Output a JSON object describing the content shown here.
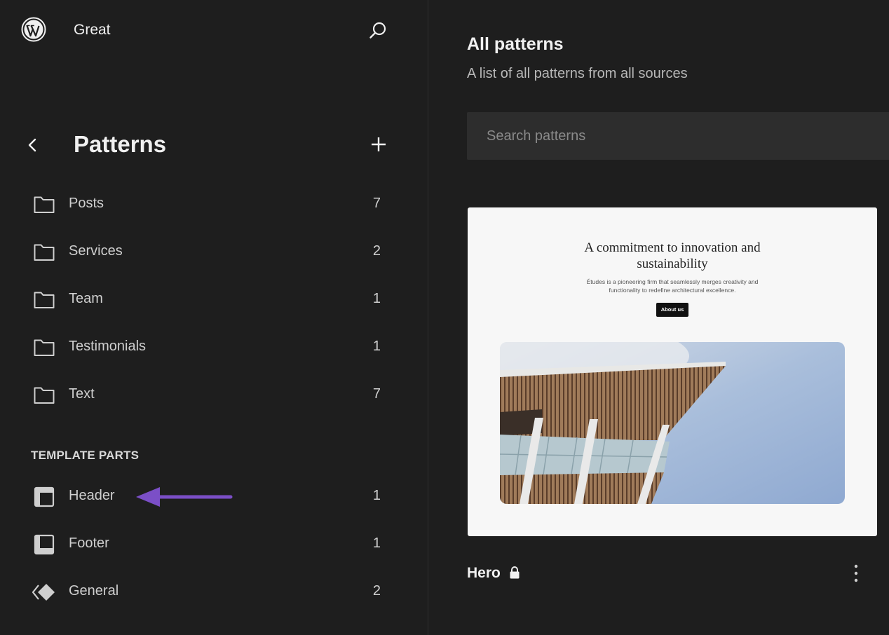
{
  "header": {
    "site_name": "Great",
    "logo_icon": "wordpress-logo-icon",
    "search_icon": "search-icon"
  },
  "sidebar": {
    "title": "Patterns",
    "back_icon": "chevron-left-icon",
    "add_icon": "plus-icon",
    "categories": [
      {
        "label": "Posts",
        "count": "7",
        "icon": "folder-icon"
      },
      {
        "label": "Services",
        "count": "2",
        "icon": "folder-icon"
      },
      {
        "label": "Team",
        "count": "1",
        "icon": "folder-icon"
      },
      {
        "label": "Testimonials",
        "count": "1",
        "icon": "folder-icon"
      },
      {
        "label": "Text",
        "count": "7",
        "icon": "folder-icon"
      }
    ],
    "template_parts_heading": "TEMPLATE PARTS",
    "template_parts": [
      {
        "label": "Header",
        "count": "1",
        "icon": "header-layout-icon"
      },
      {
        "label": "Footer",
        "count": "1",
        "icon": "footer-layout-icon"
      },
      {
        "label": "General",
        "count": "2",
        "icon": "symbol-icon"
      }
    ],
    "annotation_arrow_color": "#7b4fc7"
  },
  "main": {
    "title": "All patterns",
    "description": "A list of all patterns from all sources",
    "search_placeholder": "Search patterns",
    "patterns": [
      {
        "title": "Hero",
        "locked": true,
        "preview": {
          "heading": "A commitment to innovation and sustainability",
          "text": "Études is a pioneering firm that seamlessly merges creativity and functionality to redefine architectural excellence.",
          "button": "About us"
        }
      }
    ]
  },
  "colors": {
    "background": "#1e1e1e",
    "surface": "#2d2d2d",
    "text": "#f0f0f0",
    "muted_text": "#cfcfcf"
  }
}
